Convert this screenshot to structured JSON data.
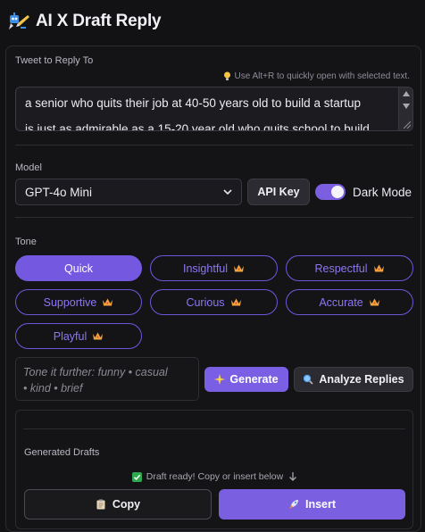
{
  "header": {
    "title": "AI X Draft Reply",
    "logo_icon": "robot-pen-icon"
  },
  "tweet": {
    "label": "Tweet to Reply To",
    "hint": "Use Alt+R to quickly open with selected text.",
    "text_line1": "a senior who quits their job at 40-50 years old to build a startup",
    "text_line2": "is just as admirable as a 15-20 year old who quits school to build"
  },
  "model": {
    "label": "Model",
    "selected": "GPT-4o Mini",
    "api_key_label": "API Key",
    "dark_mode_label": "Dark Mode",
    "dark_mode_on": true
  },
  "tone": {
    "label": "Tone",
    "chips": [
      {
        "label": "Quick",
        "active": true,
        "premium": false
      },
      {
        "label": "Insightful",
        "active": false,
        "premium": true
      },
      {
        "label": "Respectful",
        "active": false,
        "premium": true
      },
      {
        "label": "Supportive",
        "active": false,
        "premium": true
      },
      {
        "label": "Curious",
        "active": false,
        "premium": true
      },
      {
        "label": "Accurate",
        "active": false,
        "premium": true
      },
      {
        "label": "Playful",
        "active": false,
        "premium": true
      }
    ],
    "placeholder_line1": "Tone it further: funny • casual",
    "placeholder_line2": "• kind • brief",
    "generate_label": "Generate",
    "analyze_label": "Analyze Replies"
  },
  "drafts": {
    "label": "Generated Drafts",
    "status": "Draft ready! Copy or insert below",
    "copy_label": "Copy",
    "insert_label": "Insert"
  },
  "colors": {
    "accent": "#7458e0",
    "background": "#121214",
    "panel_border": "#2b2b31"
  }
}
